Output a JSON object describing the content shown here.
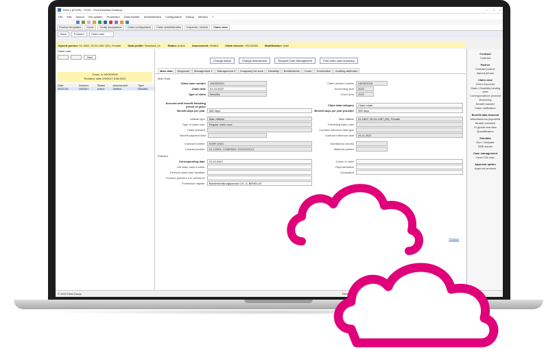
{
  "app": {
    "title": "Elvis 1 (ELVIS) - XXXX - Elvis Business Desktop - "
  },
  "window_controls": [
    "–",
    "□",
    "×"
  ],
  "menu": [
    "File",
    "Edit",
    "Search",
    "Info system",
    "Production",
    "Data transfer",
    "Administration",
    "Configuration",
    "Debug",
    "Window",
    "?"
  ],
  "module_tabs": [
    "Product templates",
    "Cover",
    "Treaty acceptance",
    "Claim configuration",
    "Claim administration",
    "Inspector / Admin",
    "Claim case"
  ],
  "nav": {
    "back": "Back",
    "forward": "Forward",
    "field": "Claim case"
  },
  "infobar": {
    "insured_label": "Injured person:",
    "insured": "01-1862, 26-04-1987 (39), Female",
    "profile_label": "Data profile:",
    "profile": "Standard_UL",
    "status_label": "Status:",
    "status": "Active",
    "assessment_label": "Assessment:",
    "assessment": "Settled",
    "dossier_label": "Claim dossier:",
    "dossier": "100-00000",
    "mod_label": "Modification:",
    "mod": "Valid"
  },
  "left": {
    "header": "Claim case",
    "new_btn": "New",
    "box_line1": "Cover: nr 00/00/0000",
    "box_line2": "Revision: date 2/9/2017 8:38:2022",
    "columns": [
      "Date",
      "Number",
      "Status",
      "Assessment",
      "Type"
    ],
    "rows": [
      [
        "05/11/20..",
        "ÜA0001",
        "Active",
        "Settled",
        "Benefits"
      ]
    ]
  },
  "actions": [
    "Change status",
    "Change assessment",
    "Request Case Management",
    "Print claim case summary"
  ],
  "tabs": [
    "Main data",
    "Diagnosis",
    "Management 1",
    "Management 2",
    "Incapacity for work",
    "Disability",
    "Beneficiaries",
    "Cover",
    "Termination",
    "Auditing attributes"
  ],
  "main": {
    "sec1": "Main Data",
    "claim_case_number_label": "Claim case number",
    "claim_case_number": "ÜA0000001",
    "claim_date_label": "Claim date",
    "claim_date": "01.10.2022",
    "type_of_claim_label": "Type of claim",
    "type_of_claim": "Benefits",
    "claim_dossier_number_label": "Claim dossier number",
    "claim_dossier_number": "UA0001025",
    "accounting_year_label": "Accounting year",
    "accounting_year": "2022",
    "cover_year_label": "Cover year",
    "cover_year": "2022",
    "benefit_acc_label": "Accrued until benefit following period of grace",
    "benefit_days_label": "Benefit days per year",
    "benefit_days": "365 days",
    "claim_cat_label": "Claim data category",
    "claim_cat": "Claim made",
    "benefit_days_prov_label": "Benefit days per year provider",
    "benefit_days_prov": "365 days",
    "affiliate_type_label": "Affiliate type",
    "affiliate_type": "Main affiliate",
    "type_claim_case_label": "Type of claim case",
    "type_claim_case": "Regular claim case",
    "claim_demand_label": "Claim demand",
    "claim_demand": "",
    "benefit_payment_label": "Benefit payment start",
    "benefit_payment": "",
    "main_affiliate_label": "Main affiliate",
    "main_affiliate": "01-1862, 26-04-1987 (39), Female",
    "preceding_label": "Preceding claim case",
    "preceding": "",
    "contract_ref_label": "Contract reference date type",
    "contract_ref": "",
    "contract_ref_date_label": "Contract reference date",
    "contract_ref_date": "24.11.2021",
    "contract_number_label": "Contract number",
    "contract_number": "KGRF-0001",
    "contract_partner_label": "Contract partner",
    "contract_partner": "22-1/2001, COMPANY, XXXXXXXXX",
    "operational_label": "Operational country",
    "operational": "",
    "matched_label": "Matched partner",
    "matched": "",
    "sec2": "Protocol",
    "corr_date_label": "Corresponding date",
    "corr_date": "01.10.2022",
    "old_claim_label": "Old claim case number",
    "old_claim": "",
    "ext_claim_label": "External claim case identifier",
    "ext_claim": "",
    "contract_ext_label": "Contract partner's ext. reference",
    "contract_ext": "",
    "prof_register_label": "Profession register",
    "prof_register": "Bankenberatungsperson CH, O, BENELUX",
    "cause_label": "Cause of claim",
    "cause": "",
    "representative_label": "Representative",
    "representative": "",
    "occupation_label": "Occupation",
    "occupation": "",
    "link": "Protocol"
  },
  "right": [
    {
      "head": "Contract",
      "items": [
        "Contract"
      ]
    },
    {
      "head": "Partner",
      "items": [
        "Contract partner",
        "Injured person"
      ]
    },
    {
      "head": "Claim case",
      "items": [
        "Claim exposure",
        "Claim / Disability binding case",
        "Correspondence protocol",
        "Reserving",
        "Benefit transfer",
        "Claim notification"
      ]
    },
    {
      "head": "Benefit data transmit",
      "items": [
        "Miscellaneous payments",
        "Benefit overview",
        "IS global overview",
        "Quantification"
      ]
    },
    {
      "head": "Simulate",
      "items": [
        "Run / Simulate",
        "BRE issues"
      ]
    },
    {
      "head": "Case management",
      "items": [
        "Open CM case"
      ]
    },
    {
      "head": "Approval option",
      "items": [
        "Approval protocol"
      ]
    }
  ],
  "status": "© 2022 Elvis Group",
  "status_right": "Elvis",
  "cloud_color": "#e0007a"
}
